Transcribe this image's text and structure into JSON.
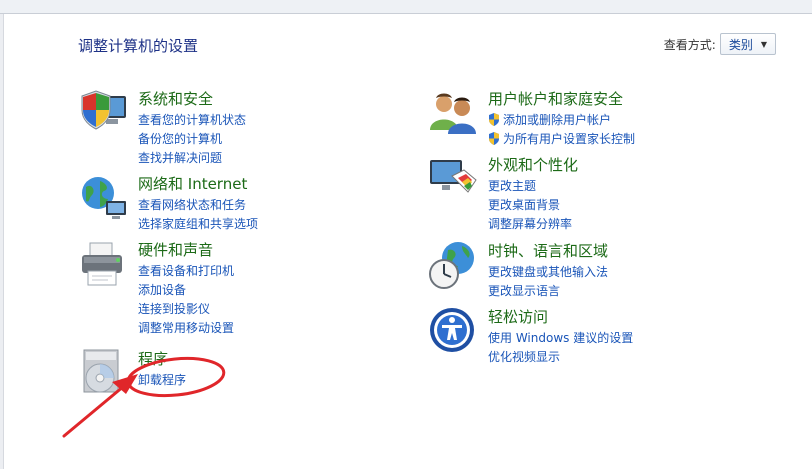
{
  "header": {
    "title": "调整计算机的设置",
    "view_label": "查看方式:",
    "view_value": "类别"
  },
  "categories": [
    {
      "title": "系统和安全",
      "icon": "shield-computer-icon",
      "links": [
        "查看您的计算机状态",
        "备份您的计算机",
        "查找并解决问题"
      ]
    },
    {
      "title": "网络和 Internet",
      "icon": "network-globe-icon",
      "links": [
        "查看网络状态和任务",
        "选择家庭组和共享选项"
      ]
    },
    {
      "title": "硬件和声音",
      "icon": "printer-icon",
      "links": [
        "查看设备和打印机",
        "添加设备",
        "连接到投影仪",
        "调整常用移动设置"
      ]
    },
    {
      "title": "程序",
      "icon": "programs-disc-icon",
      "links": [
        "卸载程序"
      ]
    },
    {
      "title": "用户帐户和家庭安全",
      "icon": "users-icon",
      "links": [
        "添加或删除用户帐户",
        "为所有用户设置家长控制"
      ]
    },
    {
      "title": "外观和个性化",
      "icon": "appearance-monitor-icon",
      "links": [
        "更改主题",
        "更改桌面背景",
        "调整屏幕分辨率"
      ]
    },
    {
      "title": "时钟、语言和区域",
      "icon": "clock-globe-icon",
      "links": [
        "更改键盘或其他输入法",
        "更改显示语言"
      ]
    },
    {
      "title": "轻松访问",
      "icon": "ease-of-access-icon",
      "links": [
        "使用 Windows 建议的设置",
        "优化视频显示"
      ]
    }
  ],
  "colors": {
    "title_blue": "#1e3287",
    "category_green": "#1c6a17",
    "link_blue": "#1a55b8",
    "annotation_red": "#e0262a"
  }
}
